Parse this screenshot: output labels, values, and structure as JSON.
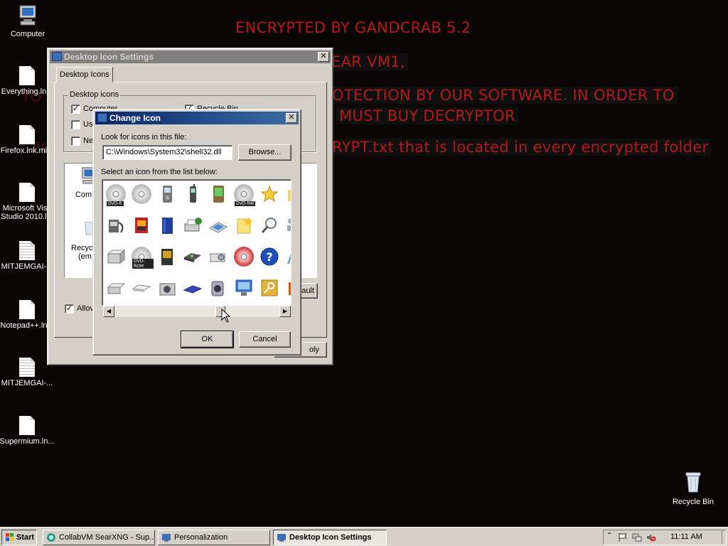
{
  "wallpaper": {
    "line1": "ENCRYPTED BY GANDCRAB 5.2",
    "line2": "EAR VM1,",
    "line3": "OTECTION BY OUR SOFTWARE. IN ORDER TO",
    "line4": "MUST BUY DECRYPTOR",
    "line5": "RYPT.txt that is located in every encrypted folder",
    "frag_yo": "YO",
    "frag_fo": "FO"
  },
  "desktop_icons": [
    {
      "label": "Computer",
      "icon": "computer-icon"
    },
    {
      "label": "Everything.ln...",
      "icon": "document-icon"
    },
    {
      "label": "Firefox.lnk.mi...",
      "icon": "document-icon"
    },
    {
      "label": "Microsoft Visu",
      "label2": "Studio 2010.l...",
      "icon": "document-icon"
    },
    {
      "label": "MITJEMGAI-...",
      "icon": "text-document-icon"
    },
    {
      "label": "Notepad++.ln...",
      "icon": "document-icon"
    },
    {
      "label": "MITJEMGAI-...",
      "icon": "text-document-icon"
    },
    {
      "label": "Supermium.ln...",
      "icon": "document-icon"
    },
    {
      "label": "Recycle Bin",
      "icon": "recycle-bin-icon"
    }
  ],
  "desktop_icon_settings": {
    "title": "Desktop Icon Settings",
    "tab": "Desktop Icons",
    "group": "Desktop icons",
    "chk_computer": "Computer",
    "chk_recycle": "Recycle Bin",
    "chk_user_frag": "Us",
    "chk_network_frag": "Ne",
    "preview_computer": "Comp",
    "preview_recycle": "Recyc",
    "preview_recycle2": "(em",
    "restore_frag": "ault",
    "allow_frag": "Allov",
    "apply_frag": "oly"
  },
  "change_icon": {
    "title": "Change Icon",
    "look_label": "Look for icons in this file:",
    "file_path": "C:\\Windows\\System32\\shell32.dll",
    "browse": "Browse...",
    "select_label": "Select an icon from the list below:",
    "ok": "OK",
    "cancel": "Cancel",
    "icons_row1": [
      "dvd-r-disc-icon",
      "cd-disc-icon",
      "mp3-player-icon",
      "mobile-phone-icon",
      "pda-icon",
      "dvd-rw-disc-icon",
      "star-icon",
      "folder-icon"
    ],
    "icons_row2": [
      "media-device-icon",
      "film-icon",
      "blue-book-icon",
      "network-printer-icon",
      "scanner-icon",
      "sticky-note-icon",
      "magnifier-icon",
      "network-user-icon"
    ],
    "icons_row3": [
      "drive-icon",
      "dvd-rom-disc-icon",
      "media-player-icon",
      "removable-drive-icon",
      "projector-icon",
      "cd-burn-icon",
      "help-icon",
      "arrow-icon"
    ],
    "icons_row4": [
      "hard-drive-icon",
      "flat-drive-icon",
      "camera-icon",
      "disk-icon",
      "camcorder-icon",
      "network-display-icon",
      "key-icon",
      "red-icon"
    ],
    "disc_tags": {
      "dvd_r": "DVD-R",
      "dvd_rw": "DVD-RW",
      "dvd_rom": "DVD-ROM"
    }
  },
  "taskbar": {
    "start": "Start",
    "tasks": [
      "CollabVM SearXNG - Sup...",
      "Personalization",
      "Desktop Icon Settings"
    ],
    "clock": "11:11 AM"
  }
}
